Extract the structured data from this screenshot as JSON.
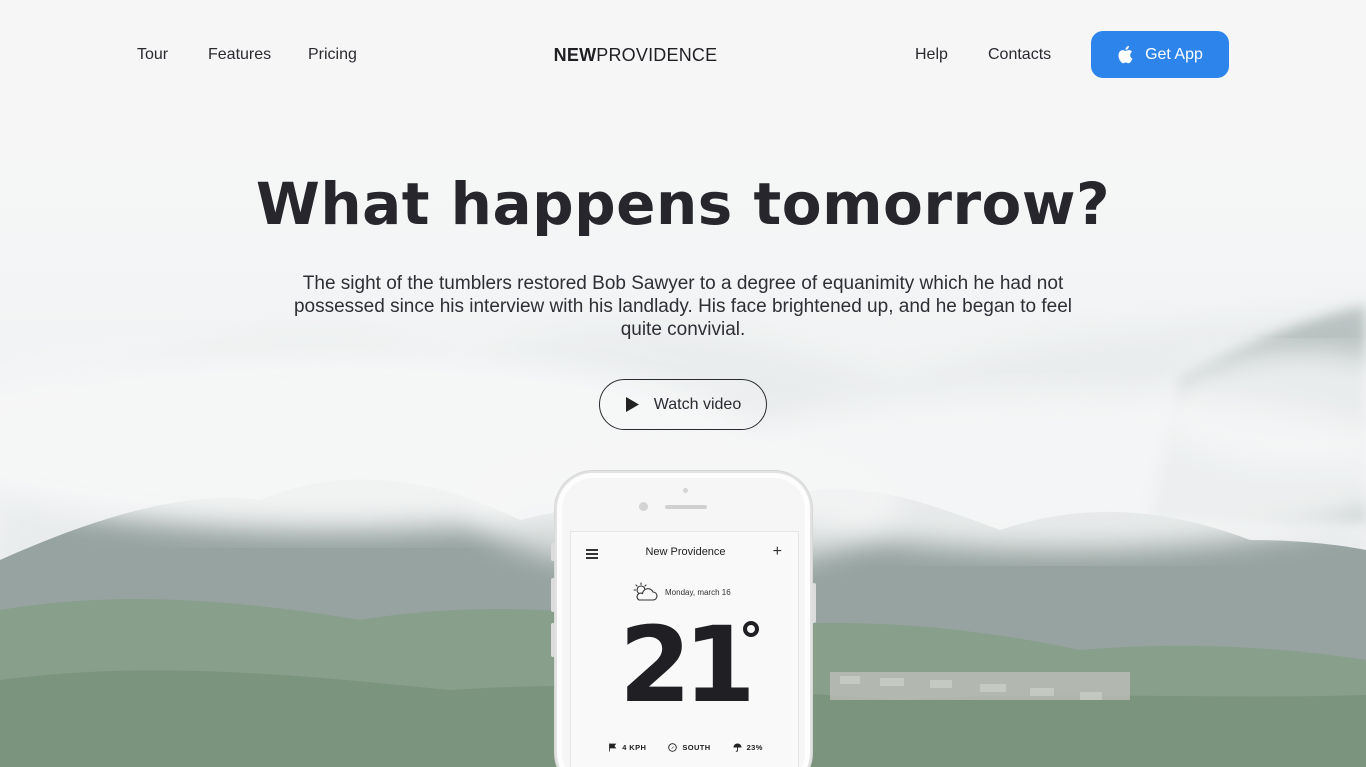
{
  "nav": {
    "left": [
      "Tour",
      "Features",
      "Pricing"
    ],
    "right": [
      "Help",
      "Contacts"
    ],
    "logo_bold": "NEW",
    "logo_rest": "PROVIDENCE",
    "get_app": "Get App",
    "get_app_icon": "apple-icon"
  },
  "hero": {
    "title": "What happens tomorrow?",
    "text": "The sight of the tumblers restored Bob Sawyer to a degree of equanimity which he had not possessed since his interview with his landlady. His face brightened up, and he began to feel quite convivial.",
    "watch_label": "Watch video",
    "watch_icon": "play-icon"
  },
  "phone": {
    "city": "New Providence",
    "date": "Monday, march 16",
    "weather_icon": "partly-cloudy-icon",
    "temperature": "21",
    "stats": [
      {
        "icon": "wind-flag-icon",
        "label": "4 KPH"
      },
      {
        "icon": "compass-icon",
        "label": "SOUTH"
      },
      {
        "icon": "umbrella-icon",
        "label": "23%"
      }
    ]
  },
  "colors": {
    "accent": "#2d85ec",
    "text": "#2a2a30",
    "background": "#f3f4f5"
  }
}
